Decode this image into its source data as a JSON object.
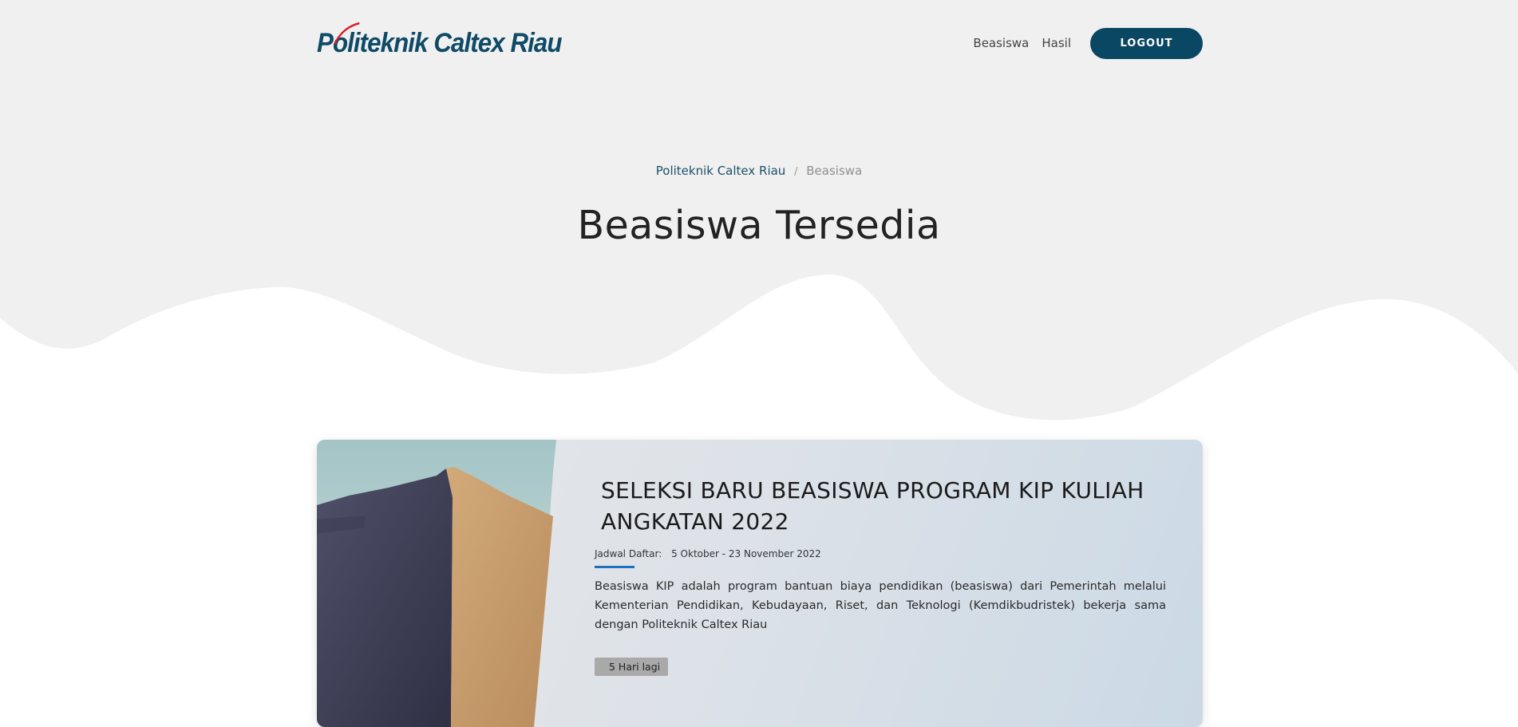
{
  "header": {
    "logo_text": "Politeknik Caltex Riau",
    "nav": {
      "beasiswa_label": "Beasiswa",
      "hasil_label": "Hasil",
      "logout_label": "LOGOUT"
    }
  },
  "breadcrumb": {
    "home": "Politeknik Caltex Riau",
    "separator": "/",
    "current": "Beasiswa"
  },
  "page_title": "Beasiswa Tersedia",
  "scholarships": [
    {
      "title": "SELEKSI BARU BEASISWA PROGRAM KIP KULIAH ANGKATAN 2022",
      "schedule_label": "Jadwal Daftar:",
      "schedule_value": "5 Oktober - 23 November 2022",
      "description": "Beasiswa KIP adalah program bantuan biaya pendidikan (beasiswa) dari Pemerintah melalui Kementerian Pendidikan, Kebudayaan, Riset, dan Teknologi (Kemdikbudristek) bekerja sama dengan Politeknik Caltex Riau",
      "days_left": "5 Hari lagi",
      "image": "desert-sand-dune"
    }
  ],
  "colors": {
    "brand": "#0a4763",
    "hero_bg": "#f0f0f0",
    "accent": "#1f6fbf",
    "badge": "#a9a9a9"
  }
}
